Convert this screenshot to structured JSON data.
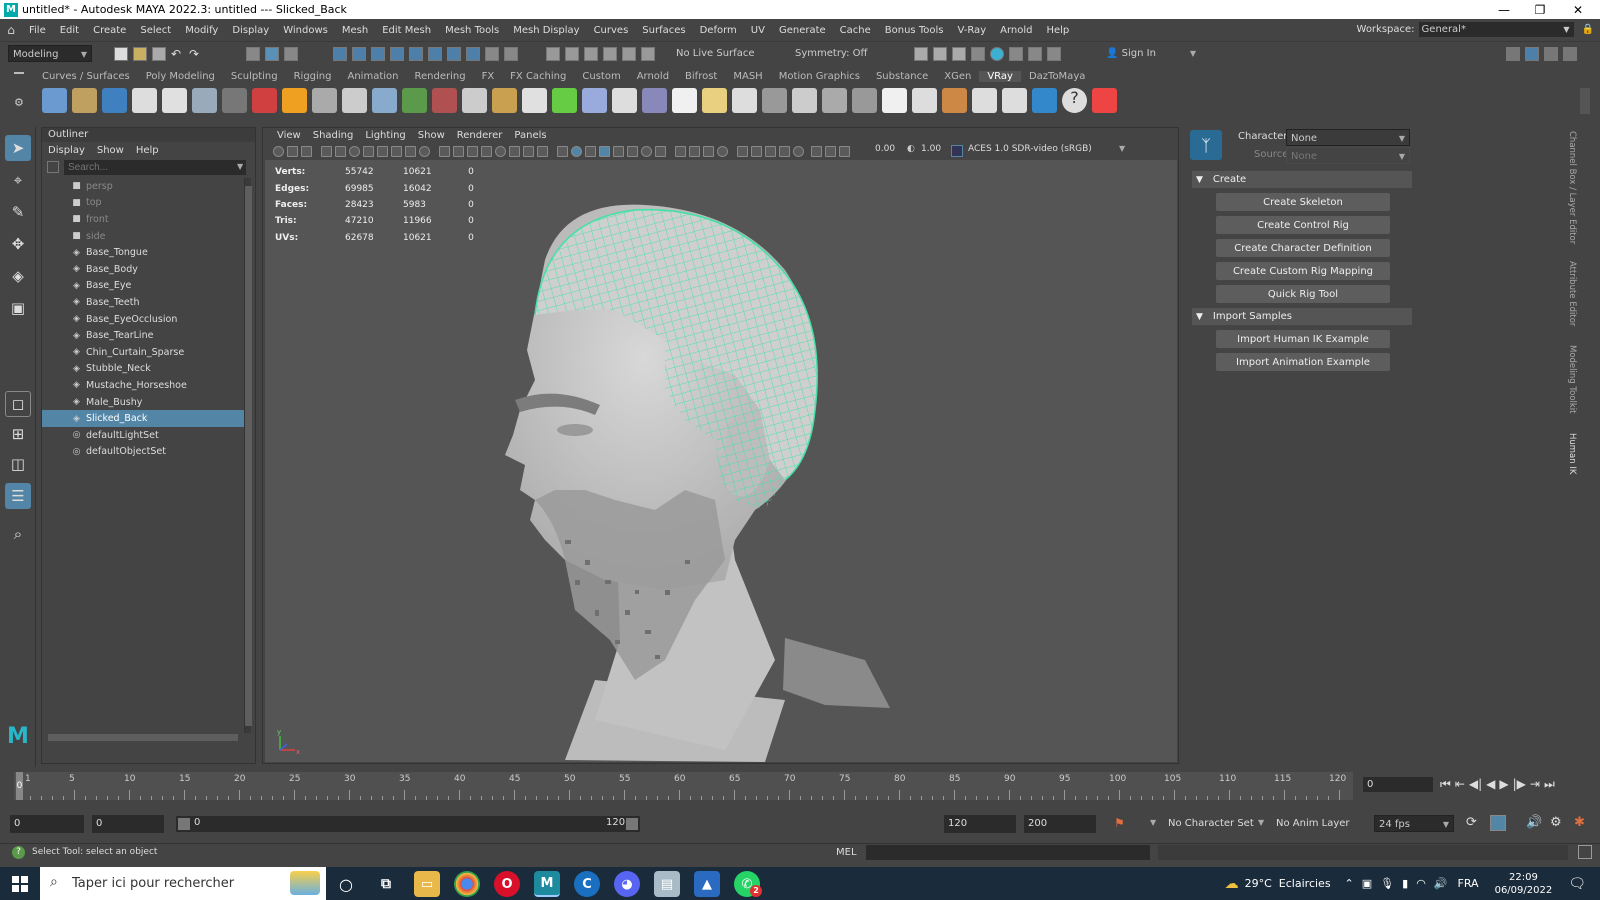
{
  "window": {
    "title": "untitled* - Autodesk MAYA 2022.3: untitled   ---   Slicked_Back"
  },
  "menubar": {
    "items": [
      "File",
      "Edit",
      "Create",
      "Select",
      "Modify",
      "Display",
      "Windows",
      "Mesh",
      "Edit Mesh",
      "Mesh Tools",
      "Mesh Display",
      "Curves",
      "Surfaces",
      "Deform",
      "UV",
      "Generate",
      "Cache",
      "Bonus Tools",
      "V-Ray",
      "Arnold",
      "Help"
    ],
    "workspace_label": "Workspace:",
    "workspace_value": "General*"
  },
  "statusline": {
    "menuset": "Modeling",
    "live_surface": "No Live Surface",
    "symmetry": "Symmetry: Off",
    "sign_in": "Sign In"
  },
  "shelf": {
    "tabs": [
      "Curves / Surfaces",
      "Poly Modeling",
      "Sculpting",
      "Rigging",
      "Animation",
      "Rendering",
      "FX",
      "FX Caching",
      "Custom",
      "Arnold",
      "Bifrost",
      "MASH",
      "Motion Graphics",
      "Substance",
      "XGen",
      "VRay",
      "DazToMaya"
    ],
    "active_tab": "VRay"
  },
  "outliner": {
    "title": "Outliner",
    "menus": [
      "Display",
      "Show",
      "Help"
    ],
    "search_placeholder": "Search...",
    "items": [
      {
        "label": "persp",
        "icon": "camera-icon",
        "dim": true
      },
      {
        "label": "top",
        "icon": "camera-icon",
        "dim": true
      },
      {
        "label": "front",
        "icon": "camera-icon",
        "dim": true
      },
      {
        "label": "side",
        "icon": "camera-icon",
        "dim": true
      },
      {
        "label": "Base_Tongue",
        "icon": "mesh-icon"
      },
      {
        "label": "Base_Body",
        "icon": "mesh-icon"
      },
      {
        "label": "Base_Eye",
        "icon": "mesh-icon"
      },
      {
        "label": "Base_Teeth",
        "icon": "mesh-icon"
      },
      {
        "label": "Base_EyeOcclusion",
        "icon": "mesh-icon"
      },
      {
        "label": "Base_TearLine",
        "icon": "mesh-icon"
      },
      {
        "label": "Chin_Curtain_Sparse",
        "icon": "mesh-icon"
      },
      {
        "label": "Stubble_Neck",
        "icon": "mesh-icon"
      },
      {
        "label": "Mustache_Horseshoe",
        "icon": "mesh-icon"
      },
      {
        "label": "Male_Bushy",
        "icon": "mesh-icon"
      },
      {
        "label": "Slicked_Back",
        "icon": "mesh-icon",
        "selected": true
      },
      {
        "label": "defaultLightSet",
        "icon": "set-icon"
      },
      {
        "label": "defaultObjectSet",
        "icon": "set-icon"
      }
    ]
  },
  "viewport": {
    "menus": [
      "View",
      "Shading",
      "Lighting",
      "Show",
      "Renderer",
      "Panels"
    ],
    "exposure": "0.00",
    "gamma": "1.00",
    "color_space": "ACES 1.0 SDR-video (sRGB)",
    "hud": [
      {
        "label": "Verts:",
        "total": "55742",
        "selected": "10621",
        "comp": "0"
      },
      {
        "label": "Edges:",
        "total": "69985",
        "selected": "16042",
        "comp": "0"
      },
      {
        "label": "Faces:",
        "total": "28423",
        "selected": "5983",
        "comp": "0"
      },
      {
        "label": "Tris:",
        "total": "47210",
        "selected": "11966",
        "comp": "0"
      },
      {
        "label": "UVs:",
        "total": "62678",
        "selected": "10621",
        "comp": "0"
      }
    ],
    "axis": {
      "x": "x",
      "y": "y"
    }
  },
  "humanik": {
    "character_label": "Character:",
    "character_value": "None",
    "source_label": "Source:",
    "source_value": "None",
    "create_section": "Create",
    "create_buttons": [
      "Create Skeleton",
      "Create Control Rig",
      "Create Character Definition",
      "Create Custom Rig Mapping",
      "Quick Rig Tool"
    ],
    "import_section": "Import Samples",
    "import_buttons": [
      "Import Human IK Example",
      "Import Animation Example"
    ],
    "side_tabs": [
      "Channel Box / Layer Editor",
      "Attribute Editor",
      "Modeling Toolkit",
      "Human IK"
    ]
  },
  "timeline": {
    "ticks": [
      1,
      5,
      10,
      15,
      20,
      25,
      30,
      35,
      40,
      45,
      50,
      55,
      60,
      65,
      70,
      75,
      80,
      85,
      90,
      95,
      100,
      105,
      110,
      115,
      120
    ],
    "current_frame": "0",
    "playhead_frame": "0"
  },
  "range": {
    "start": "0",
    "anim_start": "0",
    "slider_start": "0",
    "slider_end": "120",
    "end": "120",
    "anim_end": "200",
    "character_set": "No Character Set",
    "anim_layer": "No Anim Layer",
    "fps": "24 fps"
  },
  "helpline": {
    "message": "Select Tool: select an object",
    "mel_label": "MEL"
  },
  "taskbar": {
    "search_placeholder": "Taper ici pour rechercher",
    "weather": "29°C  Eclaircies",
    "language": "FRA",
    "time": "22:09",
    "date": "06/09/2022",
    "notification_count": "2"
  }
}
